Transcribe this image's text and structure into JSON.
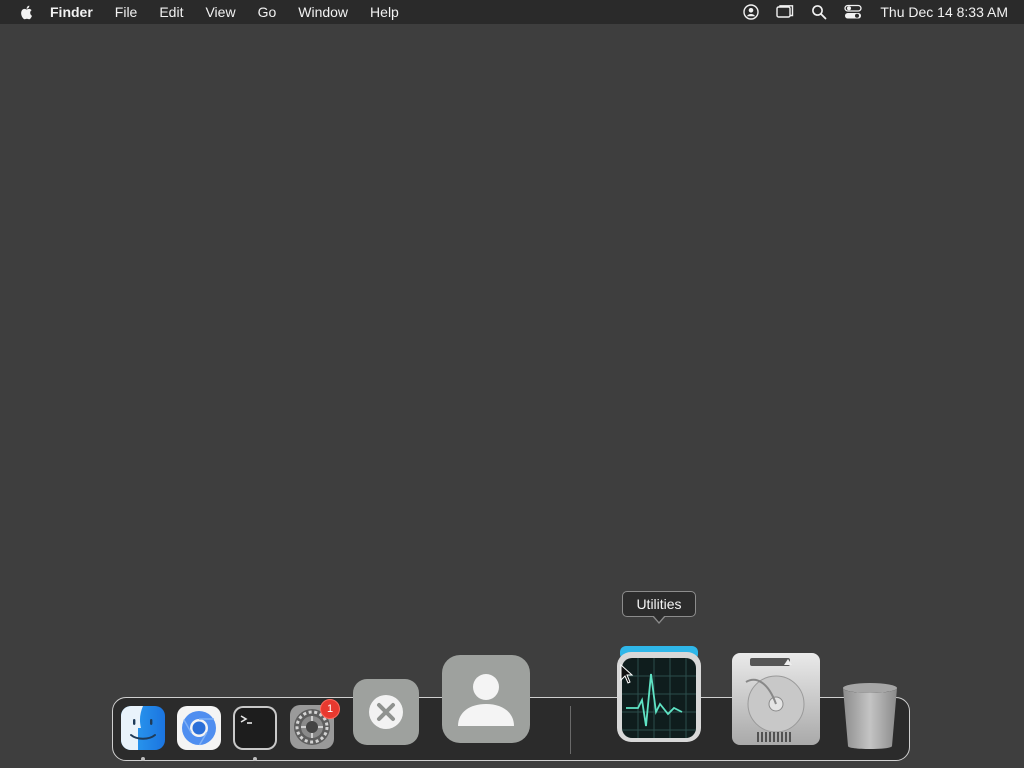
{
  "menubar": {
    "app_name": "Finder",
    "menus": [
      "File",
      "Edit",
      "View",
      "Go",
      "Window",
      "Help"
    ],
    "status_icons": [
      "user-account-icon",
      "screen-mirroring-icon",
      "spotlight-search-icon",
      "control-center-icon"
    ],
    "clock": "Thu Dec 14  8:33 AM"
  },
  "dock": {
    "apps": [
      {
        "name": "Finder",
        "icon": "finder-icon",
        "running": true
      },
      {
        "name": "Chromium",
        "icon": "chromium-icon",
        "running": false
      },
      {
        "name": "Terminal",
        "icon": "terminal-icon",
        "running": true
      },
      {
        "name": "System Settings",
        "icon": "system-settings-icon",
        "running": false,
        "badge": "1"
      },
      {
        "name": "Unknown App",
        "icon": "close-x-icon",
        "running": false
      },
      {
        "name": "Contacts",
        "icon": "person-icon",
        "running": false
      },
      {
        "name": "Utilities",
        "icon": "activity-monitor-icon",
        "running": false
      },
      {
        "name": "Macintosh HD",
        "icon": "hard-drive-icon",
        "running": false
      },
      {
        "name": "Trash",
        "icon": "trash-icon",
        "running": false
      }
    ],
    "tooltip": "Utilities"
  },
  "colors": {
    "desktop": "#3e3e3e",
    "menubar": "#2a2a2a",
    "badge": "#e8392f"
  }
}
